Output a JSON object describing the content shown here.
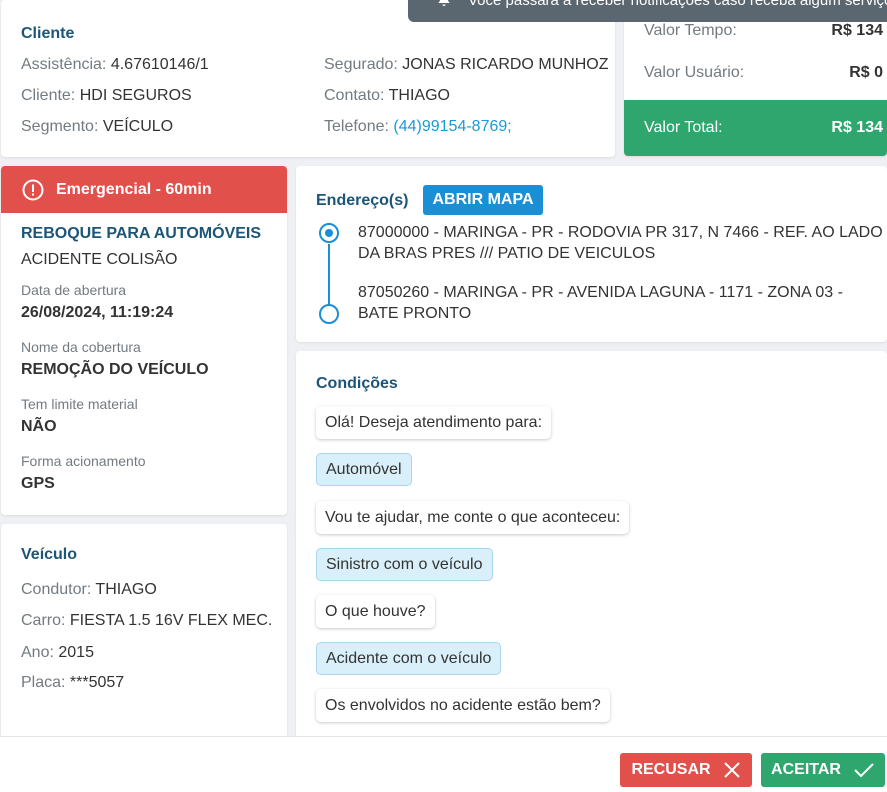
{
  "toast": {
    "text": "Você passará a receber notificações caso receba algum serviço ou"
  },
  "cliente": {
    "title": "Cliente",
    "assistencia": {
      "label": "Assistência:",
      "value": "4.67610146/1"
    },
    "cliente": {
      "label": "Cliente:",
      "value": "HDI SEGUROS"
    },
    "segmento": {
      "label": "Segmento:",
      "value": "VEÍCULO"
    },
    "segurado": {
      "label": "Segurado:",
      "value": "JONAS RICARDO MUNHOZ"
    },
    "contato": {
      "label": "Contato:",
      "value": "THIAGO"
    },
    "telefone": {
      "label": "Telefone:",
      "value": "(44)99154-8769;"
    }
  },
  "valores": {
    "tempo": {
      "label": "Valor Tempo:",
      "value": "R$ 134"
    },
    "usuario": {
      "label": "Valor Usuário:",
      "value": "R$ 0"
    },
    "total": {
      "label": "Valor Total:",
      "value": "R$ 134"
    }
  },
  "servico": {
    "emergencia": "Emergencial - 60min",
    "title": "REBOQUE PARA AUTOMÓVEIS",
    "subtitle": "ACIDENTE COLISÃO",
    "fields": [
      {
        "label": "Data de abertura",
        "value": "26/08/2024, 11:19:24"
      },
      {
        "label": "Nome da cobertura",
        "value": "REMOÇÃO DO VEÍCULO"
      },
      {
        "label": "Tem limite material",
        "value": "NÃO"
      },
      {
        "label": "Forma acionamento",
        "value": "GPS"
      }
    ]
  },
  "veiculo": {
    "title": "Veículo",
    "condutor": {
      "label": "Condutor:",
      "value": "THIAGO"
    },
    "carro": {
      "label": "Carro:",
      "value": "FIESTA 1.5 16V FLEX MEC."
    },
    "ano": {
      "label": "Ano:",
      "value": "2015"
    },
    "placa": {
      "label": "Placa:",
      "value": "***5057"
    }
  },
  "endereco": {
    "title": "Endereço(s)",
    "mapa_label": "ABRIR MAPA",
    "origem": "87000000 - MARINGA - PR - RODOVIA PR 317, N 7466 - REF. AO LADO DA BRAS PRES /// PATIO DE VEICULOS",
    "destino": "87050260 - MARINGA - PR - AVENIDA LAGUNA - 1171 - ZONA 03 - BATE PRONTO"
  },
  "condicoes": {
    "title": "Condições",
    "messages": [
      {
        "type": "q",
        "text": "Olá! Deseja atendimento para:"
      },
      {
        "type": "a",
        "text": "Automóvel"
      },
      {
        "type": "q",
        "text": "Vou te ajudar, me conte o que aconteceu:"
      },
      {
        "type": "a",
        "text": "Sinistro com o veículo"
      },
      {
        "type": "q",
        "text": "O que houve?"
      },
      {
        "type": "a",
        "text": "Acidente com o veículo"
      },
      {
        "type": "q",
        "text": "Os envolvidos no acidente estão bem?"
      },
      {
        "type": "a",
        "text": ""
      }
    ]
  },
  "footer": {
    "recusar": "RECUSAR",
    "aceitar": "ACEITAR"
  },
  "colors": {
    "primary": "#1a8fd6",
    "danger": "#e2504c",
    "success": "#2ea66e",
    "title": "#1c5577"
  }
}
